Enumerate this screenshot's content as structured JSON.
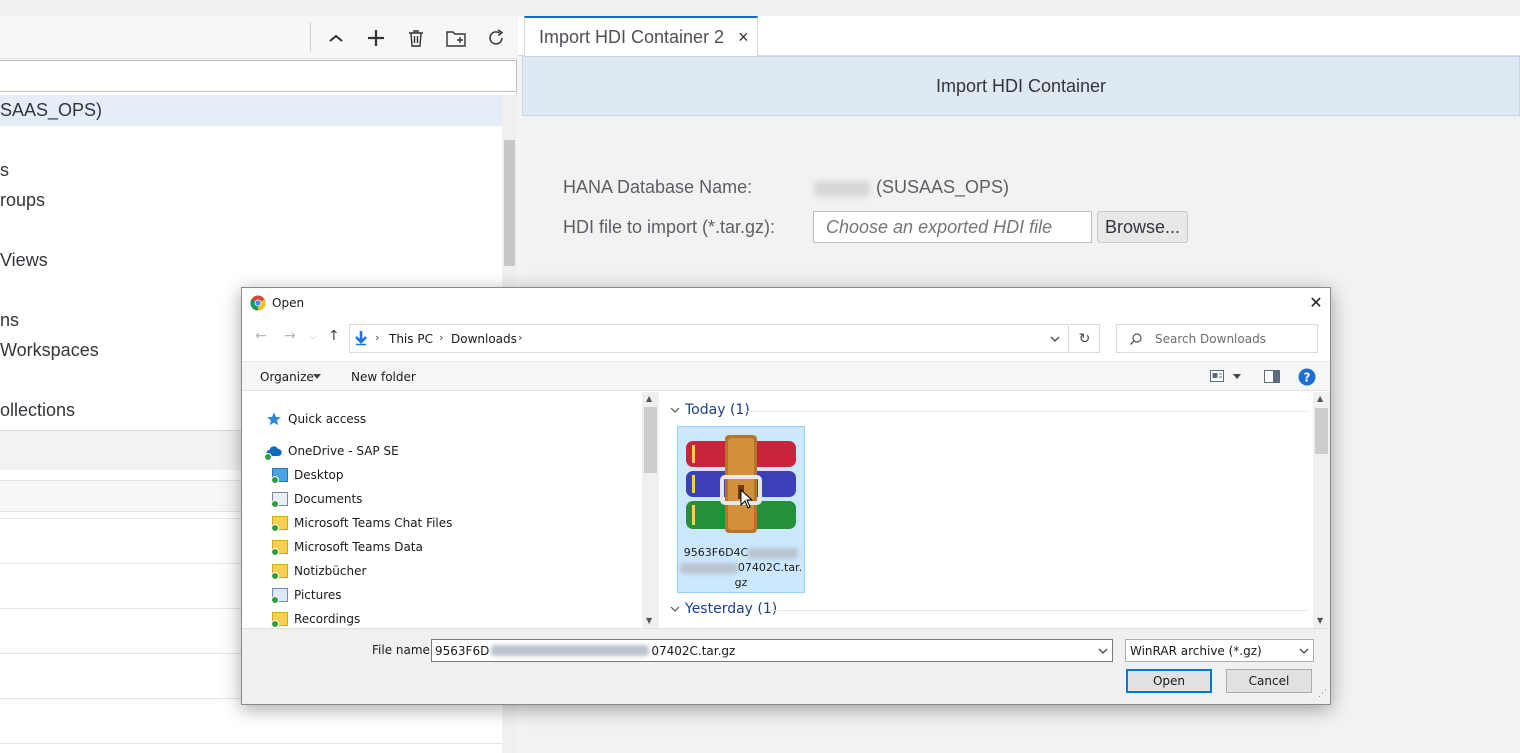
{
  "left_panel": {
    "tree_items": [
      {
        "label": "SAAS_OPS)"
      },
      {
        "label": "s"
      },
      {
        "label": "roups"
      },
      {
        "label": " Views"
      },
      {
        "label": "ns"
      },
      {
        "label": "Workspaces"
      },
      {
        "label": "ollections"
      }
    ]
  },
  "tab": {
    "label": "Import HDI Container 2",
    "close": "×"
  },
  "panel": {
    "title": "Import HDI Container",
    "db_label": "HANA Database Name:",
    "db_value": "(SUSAAS_OPS)",
    "file_label": "HDI file to import (*.tar.gz):",
    "file_placeholder": "Choose an exported HDI file",
    "browse": "Browse..."
  },
  "dialog": {
    "title": "Open",
    "close": "✕",
    "breadcrumb": [
      "This PC",
      "Downloads"
    ],
    "search_placeholder": "Search Downloads",
    "toolbar": {
      "organize": "Organize",
      "new_folder": "New folder"
    },
    "nav_items": [
      {
        "label": "Quick access"
      },
      {
        "label": "OneDrive - SAP SE"
      },
      {
        "label": "Desktop"
      },
      {
        "label": "Documents"
      },
      {
        "label": "Microsoft Teams Chat Files"
      },
      {
        "label": "Microsoft Teams Data"
      },
      {
        "label": "Notizbücher"
      },
      {
        "label": "Pictures"
      },
      {
        "label": "Recordings"
      }
    ],
    "groups": [
      {
        "label": "Today (1)"
      },
      {
        "label": "Yesterday (1)"
      }
    ],
    "file": {
      "name_part1": "9563F6D4C",
      "name_part2": "07402C.tar.",
      "name_part3": "gz"
    },
    "file_name_label": "File name:",
    "file_name_start": "9563F6D",
    "file_name_end": "07402C.tar.gz",
    "file_type": "WinRAR archive (*.gz)",
    "open_button": "Open",
    "cancel_button": "Cancel"
  },
  "colors": {
    "accent": "#0a6ed1",
    "header_bg": "#dfe9f4",
    "selection": "#cce8ff"
  }
}
